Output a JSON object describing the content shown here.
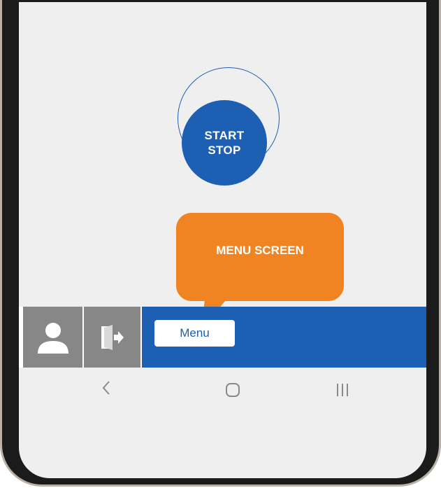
{
  "main": {
    "start_button_line1": "START",
    "start_button_line2": "STOP"
  },
  "callout": {
    "label": "MENU SCREEN",
    "color": "#f08422"
  },
  "bottom_bar": {
    "menu_label": "Menu",
    "accent_color": "#1d5fb3",
    "tabs": [
      {
        "icon": "user-icon"
      },
      {
        "icon": "logout-icon"
      }
    ]
  },
  "system_nav": {
    "buttons": [
      "back-icon",
      "home-icon",
      "recent-apps-icon"
    ]
  }
}
